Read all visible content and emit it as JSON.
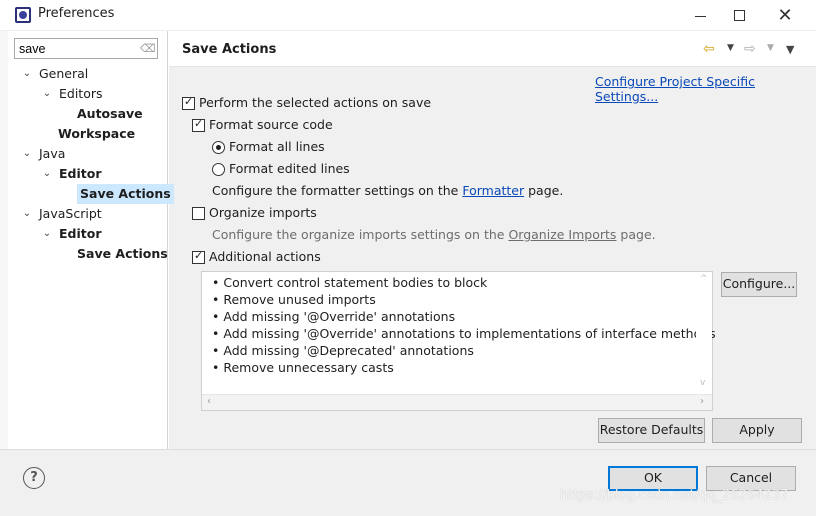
{
  "window": {
    "title": "Preferences",
    "minimize": "—",
    "maximize": "",
    "close": "✕"
  },
  "filter": {
    "value": "save",
    "clear_icon": "eraser-icon"
  },
  "tree": [
    {
      "label": "General",
      "arrow": "⌄",
      "bold": false
    },
    {
      "label": "Editors",
      "arrow": "⌄",
      "bold": false
    },
    {
      "label": "Autosave",
      "arrow": "",
      "bold": true
    },
    {
      "label": "Workspace",
      "arrow": "",
      "bold": true
    },
    {
      "label": "Java",
      "arrow": "⌄",
      "bold": false
    },
    {
      "label": "Editor",
      "arrow": "⌄",
      "bold": true
    },
    {
      "label": "Save Actions",
      "arrow": "",
      "bold": true
    },
    {
      "label": "JavaScript",
      "arrow": "⌄",
      "bold": false
    },
    {
      "label": "Editor",
      "arrow": "⌄",
      "bold": true
    },
    {
      "label": "Save Actions",
      "arrow": "",
      "bold": true
    }
  ],
  "page": {
    "title": "Save Actions",
    "configure_project_link": "Configure Project Specific Settings...",
    "perform_label": "Perform the selected actions on save",
    "format_label": "Format source code",
    "format_all_label": "Format all lines",
    "format_edited_label": "Format edited lines",
    "formatter_text_before": "Configure the formatter settings on the",
    "formatter_link": "Formatter",
    "formatter_text_after": "page.",
    "organize_label": "Organize imports",
    "organize_text_before": "Configure the organize imports settings on the",
    "organize_link": "Organize Imports",
    "organize_text_after": "page.",
    "additional_label": "Additional actions",
    "additional_items": [
      "Convert control statement bodies to block",
      "Remove unused imports",
      "Add missing '@Override' annotations",
      "Add missing '@Override' annotations to implementations of interface methods",
      "Add missing '@Deprecated' annotations",
      "Remove unnecessary casts"
    ],
    "configure_button": "Configure...",
    "restore_defaults_button": "Restore Defaults",
    "apply_button": "Apply"
  },
  "state": {
    "perform_checked": true,
    "format_checked": true,
    "format_all_selected": true,
    "organize_checked": false,
    "additional_checked": true
  },
  "footer": {
    "help": "?",
    "ok_button": "OK",
    "cancel_button": "Cancel"
  },
  "watermark": "https://blog.csdn.net/qq_26264237"
}
